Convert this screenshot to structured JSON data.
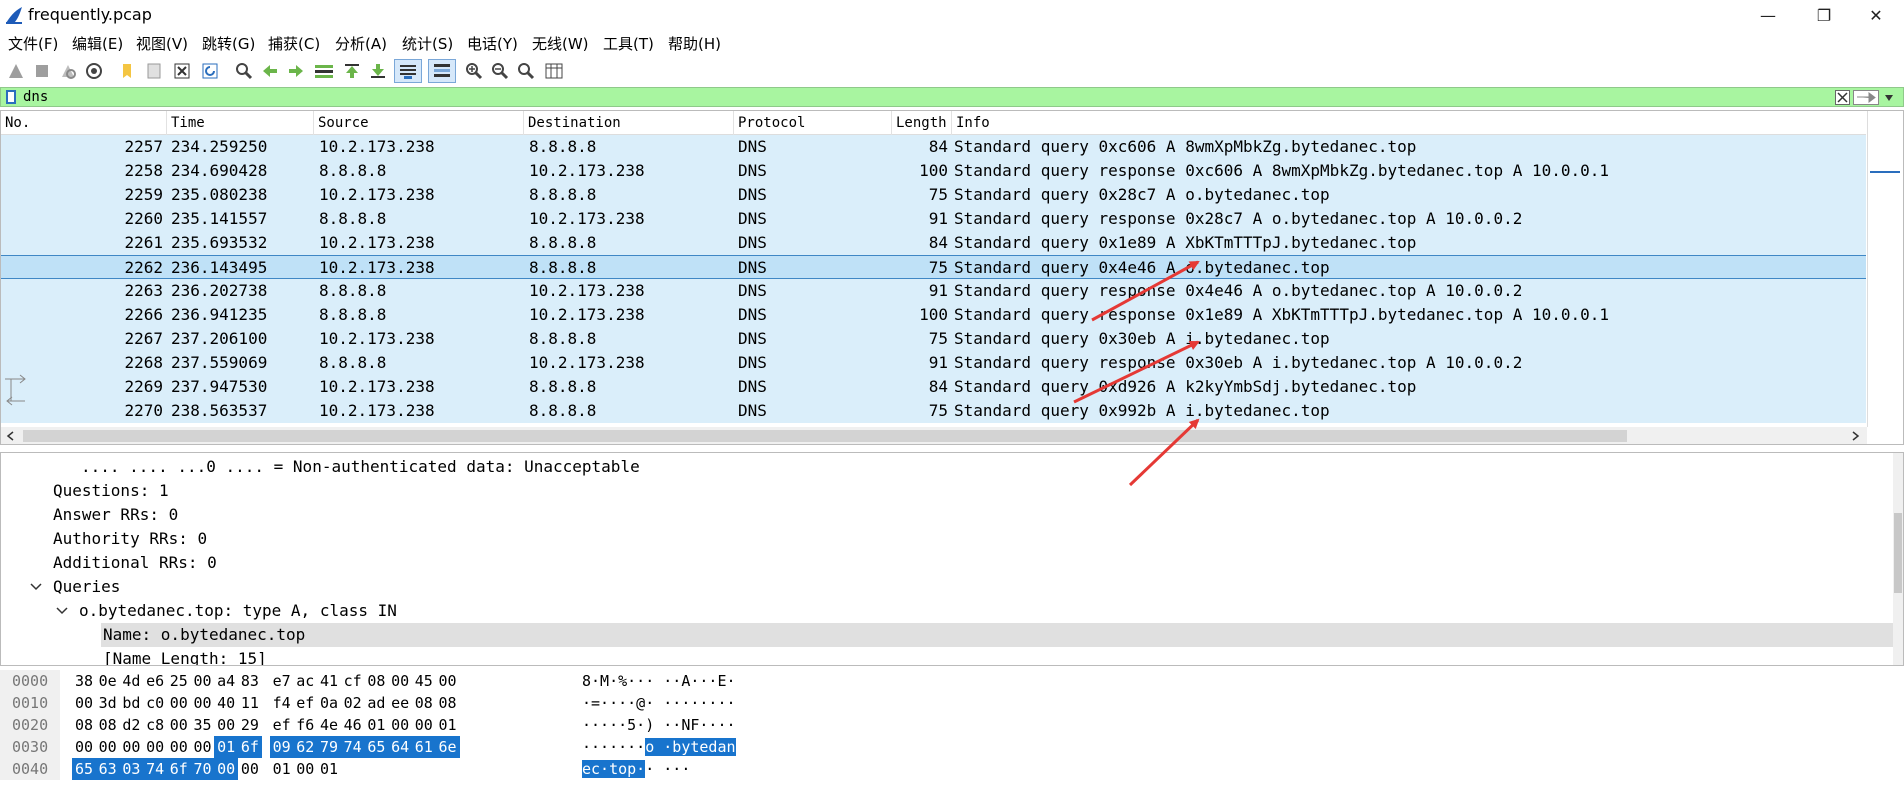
{
  "window": {
    "title": "frequently.pcap",
    "minimize": "—",
    "restore": "❐",
    "close": "✕"
  },
  "menu": [
    "文件(F)",
    "编辑(E)",
    "视图(V)",
    "跳转(G)",
    "捕获(C)",
    "分析(A)",
    "统计(S)",
    "电话(Y)",
    "无线(W)",
    "工具(T)",
    "帮助(H)"
  ],
  "toolbar_icons": [
    "start-capture-icon",
    "stop-capture-icon",
    "restart-capture-icon",
    "capture-options-icon",
    "open-file-icon",
    "save-file-icon",
    "close-file-icon",
    "reload-icon",
    "find-packet-icon",
    "go-back-icon",
    "go-forward-icon",
    "go-to-packet-icon",
    "go-first-icon",
    "go-last-icon",
    "autoscroll-icon",
    "colorize-icon",
    "zoom-in-icon",
    "zoom-out-icon",
    "zoom-normal-icon",
    "resize-columns-icon"
  ],
  "filter": {
    "value": "dns"
  },
  "columns": [
    "No.",
    "Time",
    "Source",
    "Destination",
    "Protocol",
    "Length",
    "Info"
  ],
  "packets": [
    {
      "no": "2257",
      "time": "234.259250",
      "src": "10.2.173.238",
      "dst": "8.8.8.8",
      "proto": "DNS",
      "len": "84",
      "info": "Standard query 0xc606 A 8wmXpMbkZg.bytedanec.top"
    },
    {
      "no": "2258",
      "time": "234.690428",
      "src": "8.8.8.8",
      "dst": "10.2.173.238",
      "proto": "DNS",
      "len": "100",
      "info": "Standard query response 0xc606 A 8wmXpMbkZg.bytedanec.top A 10.0.0.1"
    },
    {
      "no": "2259",
      "time": "235.080238",
      "src": "10.2.173.238",
      "dst": "8.8.8.8",
      "proto": "DNS",
      "len": "75",
      "info": "Standard query 0x28c7 A o.bytedanec.top"
    },
    {
      "no": "2260",
      "time": "235.141557",
      "src": "8.8.8.8",
      "dst": "10.2.173.238",
      "proto": "DNS",
      "len": "91",
      "info": "Standard query response 0x28c7 A o.bytedanec.top A 10.0.0.2"
    },
    {
      "no": "2261",
      "time": "235.693532",
      "src": "10.2.173.238",
      "dst": "8.8.8.8",
      "proto": "DNS",
      "len": "84",
      "info": "Standard query 0x1e89 A XbKTmTTTpJ.bytedanec.top"
    },
    {
      "no": "2262",
      "time": "236.143495",
      "src": "10.2.173.238",
      "dst": "8.8.8.8",
      "proto": "DNS",
      "len": "75",
      "info": "Standard query 0x4e46 A o.bytedanec.top",
      "selected": true
    },
    {
      "no": "2263",
      "time": "236.202738",
      "src": "8.8.8.8",
      "dst": "10.2.173.238",
      "proto": "DNS",
      "len": "91",
      "info": "Standard query response 0x4e46 A o.bytedanec.top A 10.0.0.2"
    },
    {
      "no": "2266",
      "time": "236.941235",
      "src": "8.8.8.8",
      "dst": "10.2.173.238",
      "proto": "DNS",
      "len": "100",
      "info": "Standard query response 0x1e89 A XbKTmTTTpJ.bytedanec.top A 10.0.0.1"
    },
    {
      "no": "2267",
      "time": "237.206100",
      "src": "10.2.173.238",
      "dst": "8.8.8.8",
      "proto": "DNS",
      "len": "75",
      "info": "Standard query 0x30eb A i.bytedanec.top"
    },
    {
      "no": "2268",
      "time": "237.559069",
      "src": "8.8.8.8",
      "dst": "10.2.173.238",
      "proto": "DNS",
      "len": "91",
      "info": "Standard query response 0x30eb A i.bytedanec.top A 10.0.0.2"
    },
    {
      "no": "2269",
      "time": "237.947530",
      "src": "10.2.173.238",
      "dst": "8.8.8.8",
      "proto": "DNS",
      "len": "84",
      "info": "Standard query 0xd926 A k2kyYmbSdj.bytedanec.top"
    },
    {
      "no": "2270",
      "time": "238.563537",
      "src": "10.2.173.238",
      "dst": "8.8.8.8",
      "proto": "DNS",
      "len": "75",
      "info": "Standard query 0x992b A i.bytedanec.top"
    }
  ],
  "details": [
    {
      "text": ".... .... ...0 .... = Non-authenticated data: Unacceptable",
      "toggle": ""
    },
    {
      "text": "Questions: 1",
      "toggle": ""
    },
    {
      "text": "Answer RRs: 0",
      "toggle": ""
    },
    {
      "text": "Authority RRs: 0",
      "toggle": ""
    },
    {
      "text": "Additional RRs: 0",
      "toggle": ""
    },
    {
      "text": "Queries",
      "toggle": "expanded"
    },
    {
      "text": "o.bytedanec.top: type A, class IN",
      "toggle": "expanded"
    },
    {
      "text": "Name: o.bytedanec.top",
      "toggle": "",
      "selected": true
    },
    {
      "text": "[Name Length: 15]",
      "toggle": ""
    }
  ],
  "bytes": [
    {
      "offset": "0000",
      "hex": [
        "38",
        "0e",
        "4d",
        "e6",
        "25",
        "00",
        "a4",
        "83",
        "e7",
        "ac",
        "41",
        "cf",
        "08",
        "00",
        "45",
        "00"
      ],
      "ascii": "8·M·%··· ··A···E·"
    },
    {
      "offset": "0010",
      "hex": [
        "00",
        "3d",
        "bd",
        "c0",
        "00",
        "00",
        "40",
        "11",
        "f4",
        "ef",
        "0a",
        "02",
        "ad",
        "ee",
        "08",
        "08"
      ],
      "ascii": "·=····@· ········"
    },
    {
      "offset": "0020",
      "hex": [
        "08",
        "08",
        "d2",
        "c8",
        "00",
        "35",
        "00",
        "29",
        "ef",
        "f6",
        "4e",
        "46",
        "01",
        "00",
        "00",
        "01"
      ],
      "ascii": "·····5·) ··NF····"
    },
    {
      "offset": "0030",
      "hex": [
        "00",
        "00",
        "00",
        "00",
        "00",
        "00",
        "01",
        "6f",
        "09",
        "62",
        "79",
        "74",
        "65",
        "64",
        "61",
        "6e"
      ],
      "ascii": "·······o ·bytedan"
    },
    {
      "offset": "0040",
      "hex": [
        "65",
        "63",
        "03",
        "74",
        "6f",
        "70",
        "00",
        "00",
        "01",
        "00",
        "01"
      ],
      "ascii": "ec·top·· ···"
    }
  ],
  "colors": {
    "row_bg": "#daeefa",
    "selected_row": "#bfe1f7",
    "filter_bg": "#a8f5a0",
    "byte_highlight": "#1874cd",
    "arrow": "#e53935"
  }
}
